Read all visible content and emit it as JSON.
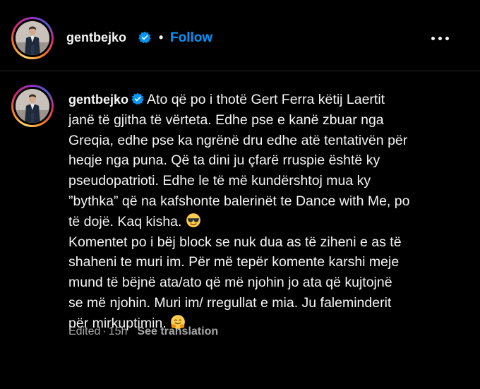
{
  "post_header": {
    "username": "gentbejko",
    "separator": "•",
    "follow_label": "Follow",
    "more_icon": "more-horizontal-icon"
  },
  "comment": {
    "username": "gentbejko",
    "line1": "Ato që po i thotë Gert Ferra këtij Laertit",
    "line2": "janë të gjitha të vërteta. Edhe pse e kanë zbuar nga",
    "line3": "Greqia, edhe pse ka ngrënë dru edhe atë tentativën për",
    "line4": "heqje nga puna. Që ta dini ju çfarë rruspie është ky",
    "line5": "pseudopatrioti. Edhe le të më kundërshtoj mua ky",
    "line6": "”bythka” që na kafshonte balerinët te Dance with Me, po",
    "line7": "të dojë. Kaq kisha.",
    "line8": "Komentet po i bëj block se nuk dua as të ziheni e as të",
    "line9": "shaheni te muri im. Për më tepër komente karshi meje",
    "line10": "mund të bëjnë ata/ato që më njohin jo ata që kujtojnë",
    "line11": "se më njohin. Muri im/ rregullat e mia. Ju faleminderit",
    "line12": "për mirkuptimin.",
    "emoji1": "sunglasses-emoji",
    "emoji2": "smiling-face-with-hearts-hands-emoji"
  },
  "meta": {
    "edited": "Edited",
    "dot": "·",
    "time": "15h",
    "see_translation": "See translation"
  },
  "colors": {
    "background": "#000000",
    "text": "#f5f5f5",
    "muted": "#a8a8a8",
    "link": "#0095f6",
    "verified": "#0095f6",
    "divider": "#262626"
  }
}
